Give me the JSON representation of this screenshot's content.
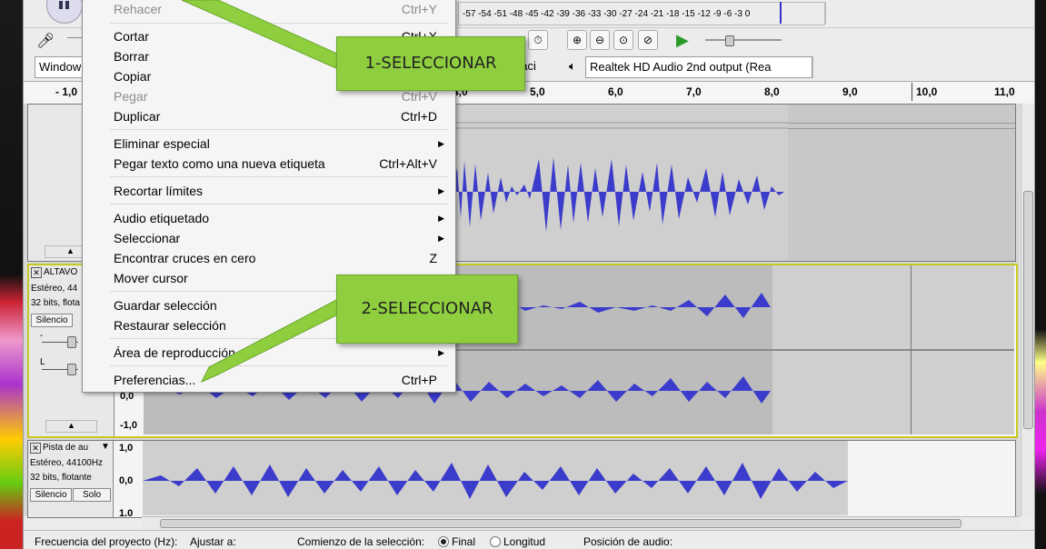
{
  "meter": {
    "scale": "-57 -54 -51 -48 -45 -42 -39 -36 -33 -30 -27 -24 -21 -18 -15 -12 -9 -6 -3 0"
  },
  "toolbar": {
    "host_select": "Window",
    "output_select": "Realtek HD Audio 2nd output (Rea",
    "input_select_partial": "baci"
  },
  "ruler": {
    "ticks": [
      "- 1,0",
      "4,0",
      "5,0",
      "6,0",
      "7,0",
      "8,0",
      "9,0",
      "10,0",
      "11,0"
    ]
  },
  "menu": {
    "items": [
      {
        "label": "Rehacer",
        "shortcut": "Ctrl+Y",
        "disabled": true
      },
      {
        "label": "Cortar",
        "shortcut": "Ctrl+X"
      },
      {
        "label": "Borrar",
        "shortcut": ""
      },
      {
        "label": "Copiar",
        "shortcut": ""
      },
      {
        "label": "Pegar",
        "shortcut": "Ctrl+V",
        "disabled": true
      },
      {
        "label": "Duplicar",
        "shortcut": "Ctrl+D"
      },
      {
        "label": "Eliminar especial",
        "submenu": true
      },
      {
        "label": "Pegar texto como una nueva etiqueta",
        "shortcut": "Ctrl+Alt+V"
      },
      {
        "label": "Recortar límites",
        "submenu": true
      },
      {
        "label": "Audio etiquetado",
        "submenu": true
      },
      {
        "label": "Seleccionar",
        "submenu": true
      },
      {
        "label": "Encontrar cruces en cero",
        "shortcut": "Z"
      },
      {
        "label": "Mover cursor",
        "submenu": true
      },
      {
        "label": "Guardar selección"
      },
      {
        "label": "Restaurar selección"
      },
      {
        "label": "Área de reproducción",
        "submenu": true
      },
      {
        "label": "Preferencias...",
        "shortcut": "Ctrl+P"
      }
    ]
  },
  "callouts": {
    "first": "1-SELECCIONAR",
    "second": "2-SELECCIONAR"
  },
  "tracks": [
    {
      "name": "ALTAVO",
      "info1": "Estéreo, 44",
      "info2": "32 bits, flota",
      "mute": "Silencio",
      "scale_top": "",
      "scale_mid": "0,0",
      "scale_bottom": "-1,0"
    },
    {
      "name": "Pista de au",
      "info1": "Estéreo, 44100Hz",
      "info2": "32 bits, flotante",
      "mute": "Silencio",
      "solo": "Solo",
      "scale_top": "1,0",
      "scale_mid": "0,0",
      "scale_bottom": "1.0"
    }
  ],
  "slider_labels": {
    "gain": "-",
    "pan": "L"
  },
  "statusbar": {
    "rate_label": "Frecuencia del proyecto (Hz):",
    "snap_label": "Ajustar a:",
    "sel_start_label": "Comienzo de la selección:",
    "end_label": "Final",
    "length_label": "Longitud",
    "audio_pos_label": "Posición de audio:"
  },
  "colors": {
    "wave": "#3b3bcc",
    "callout": "#8fcf3f"
  }
}
